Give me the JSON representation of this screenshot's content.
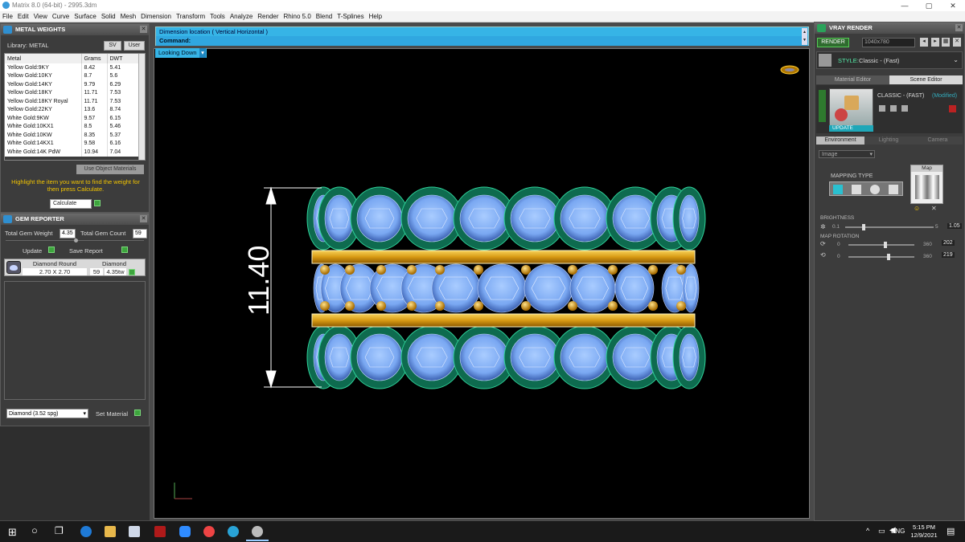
{
  "window": {
    "title": "Matrix 8.0 (64-bit) - 2995.3dm",
    "min": "—",
    "max": "▢",
    "close": "✕"
  },
  "menu": [
    "File",
    "Edit",
    "View",
    "Curve",
    "Surface",
    "Solid",
    "Mesh",
    "Dimension",
    "Transform",
    "Tools",
    "Analyze",
    "Render",
    "Rhino 5.0",
    "Blend",
    "T-Splines",
    "Help"
  ],
  "metal_weights": {
    "title": "METAL WEIGHTS",
    "library_label": "Library: METAL",
    "sv_label": "SV",
    "user_label": "User",
    "columns": [
      "Metal",
      "Grams",
      "DWT"
    ],
    "rows": [
      [
        "Yellow Gold:9KY",
        "8.42",
        "5.41"
      ],
      [
        "Yellow Gold:10KY",
        "8.7",
        "5.6"
      ],
      [
        "Yellow Gold:14KY",
        "9.79",
        "6.29"
      ],
      [
        "Yellow Gold:18KY",
        "11.71",
        "7.53"
      ],
      [
        "Yellow Gold:18KY Royal",
        "11.71",
        "7.53"
      ],
      [
        "Yellow Gold:22KY",
        "13.6",
        "8.74"
      ],
      [
        "White Gold:9KW",
        "9.57",
        "6.15"
      ],
      [
        "White Gold:10KX1",
        "8.5",
        "5.46"
      ],
      [
        "White Gold:10KW",
        "8.35",
        "5.37"
      ],
      [
        "White Gold:14KX1",
        "9.58",
        "6.16"
      ],
      [
        "White Gold:14K PdW",
        "10.94",
        "7.04"
      ]
    ],
    "use_object_materials": "Use Object Materials",
    "hint": "Highlight the item you want to find the weight for then press Calculate.",
    "calculate": "Calculate"
  },
  "gem_reporter": {
    "title": "GEM REPORTER",
    "total_weight_label": "Total Gem Weight",
    "total_weight": "4.35",
    "total_count_label": "Total Gem Count",
    "total_count": "59",
    "update": "Update",
    "save_report": "Save Report",
    "gem_name": "Diamond Round",
    "gem_size": "2.70 X 2.70",
    "gem_type": "Diamond",
    "gem_count": "59",
    "gem_tw": "4.35tw",
    "material_select": "Diamond    (3.52 spg)",
    "set_material": "Set Material"
  },
  "command": {
    "line1": "Dimension location ( Vertical  Horizontal )",
    "line2": "Command:",
    "view_label": "Looking Down"
  },
  "viewport": {
    "dimension": "11.40"
  },
  "vray": {
    "title": "VRAY RENDER",
    "render": "RENDER",
    "resolution": "1040x780",
    "style_label": "STYLE:",
    "style_value": "Classic - (Fast)",
    "tab_material": "Material Editor",
    "tab_scene": "Scene Editor",
    "preset_name": "CLASSIC - (FAST)",
    "preset_state": "(Modified)",
    "update": "UPDATE",
    "env_tabs": [
      "Environment",
      "Lighting",
      "Camera"
    ],
    "env_mode": "Image",
    "mapping_type": "MAPPING TYPE",
    "map_label": "Map",
    "brightness_label": "BRIGHTNESS",
    "brightness_min": "0.1",
    "brightness_max": "5",
    "brightness_val": "1.05",
    "brightness_level": 0.21,
    "map_rotation_label": "MAP ROTATION",
    "rot1_min": "0",
    "rot1_max": "360",
    "rot1_val": "202",
    "rot1_level": 0.56,
    "rot2_min": "0",
    "rot2_max": "360",
    "rot2_val": "219",
    "rot2_level": 0.61
  },
  "taskbar": {
    "lang": "ENG",
    "time": "5:15 PM",
    "date": "12/9/2021"
  }
}
